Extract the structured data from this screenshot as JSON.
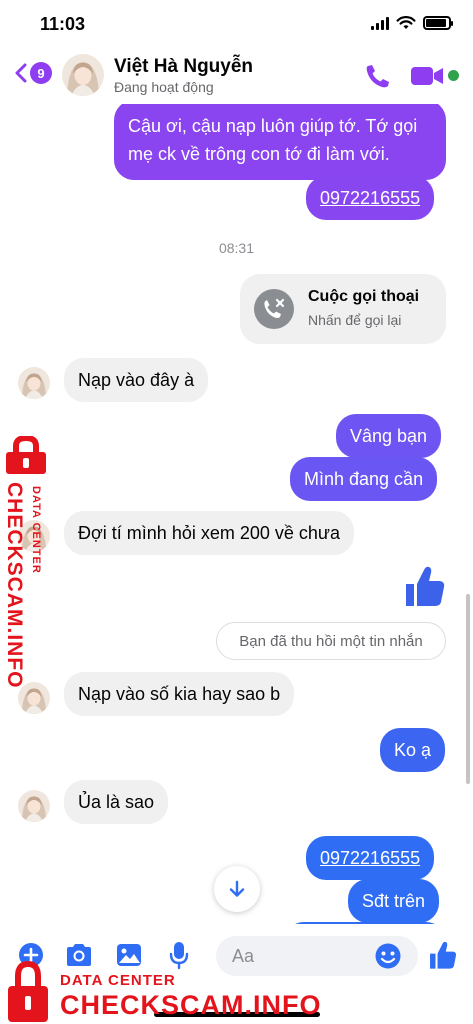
{
  "status_bar": {
    "time": "11:03",
    "battery_level": 0.9
  },
  "header": {
    "back_count": "9",
    "contact_name": "Việt Hà Nguyễn",
    "contact_status": "Đang hoạt động",
    "online": true
  },
  "colors": {
    "outgoing_top": "#8a45f0",
    "outgoing_bottom": "#2f6df5",
    "incoming": "#f0f0f0",
    "accent": "#8e3df0",
    "composer_accent": "#2f6df5",
    "watermark": "#e3141c"
  },
  "messages": {
    "m1": "Cậu ơi, cậu nạp luôn giúp tớ. Tớ gọi mẹ ck về trông con tớ đi làm với.",
    "m2": "0972216555",
    "timestamp": "08:31",
    "call_title": "Cuộc gọi thoại",
    "call_subtitle": "Nhấn để gọi lại",
    "m3": "Nạp vào đây à",
    "m4": "Vâng bạn",
    "m5": "Mình đang cần",
    "m6": "Đợi tí mình hỏi xem 200 về chưa",
    "unsent": "Bạn đã thu hồi một tin nhắn",
    "m7": "Nạp vào số kia hay sao b",
    "m8": "Ko ạ",
    "m9": "Ủa là sao",
    "m10": "0972216555",
    "m11": "Sđt trên"
  },
  "composer": {
    "placeholder": "Aa"
  },
  "watermark": {
    "title": "CHECKSCAM.INFO",
    "subtitle": "DATA CENTER"
  },
  "icons": [
    "back-chevron-icon",
    "phone-icon",
    "video-camera-icon",
    "missed-call-icon",
    "thumbs-up-icon",
    "arrow-down-icon",
    "plus-icon",
    "camera-icon",
    "image-icon",
    "microphone-icon",
    "emoji-icon",
    "lock-icon"
  ]
}
